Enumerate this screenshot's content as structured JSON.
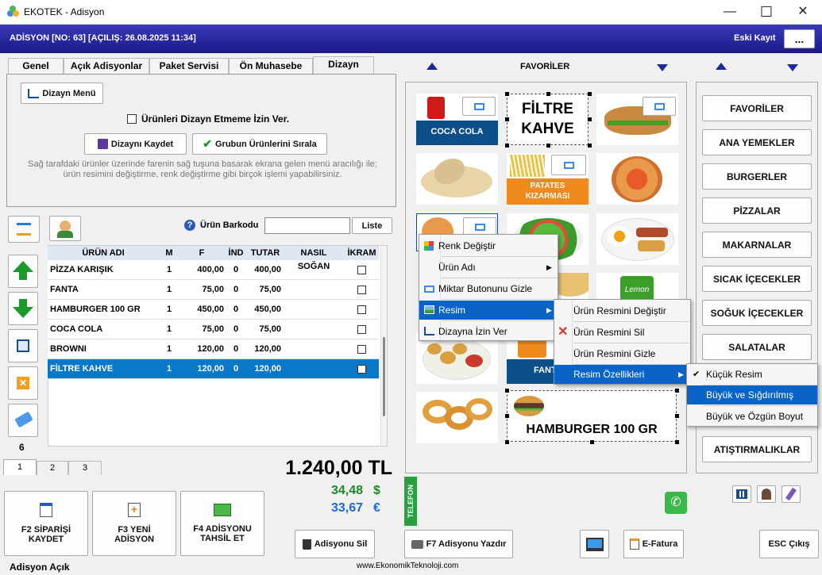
{
  "window": {
    "title": "EKOTEK - Adisyon",
    "min": "—",
    "max": "☐",
    "close": "✕"
  },
  "info": {
    "header": "ADİSYON [NO: 63] [AÇILIŞ: 26.08.2025 11:34]",
    "eski_kayit": "Eski Kayıt",
    "more": "..."
  },
  "tabs": [
    "Genel",
    "Açık Adisyonlar",
    "Paket Servisi",
    "Ön Muhasebe",
    "Dizayn"
  ],
  "design": {
    "menu_btn": "Dizayn Menü",
    "checkbox": "Ürünleri Dizayn Etmeme İzin Ver.",
    "save_btn": "Dizaynı Kaydet",
    "sort_btn": "Grubun Ürünlerini Sırala",
    "help1": "Sağ tarafdaki ürünler üzerinde farenin sağ tuşuna basarak ekrana gelen menü aracılığı ile;",
    "help2": "ürün resimini değiştirme, renk değiştirme gibi birçok işlemi yapabilirsiniz."
  },
  "barcode": {
    "label": "Ürün Barkodu",
    "value": "",
    "list_btn": "Liste"
  },
  "table": {
    "headers": [
      "ÜRÜN ADI",
      "M",
      "F",
      "İND",
      "TUTAR",
      "NASIL",
      "İKRAM"
    ],
    "rows": [
      {
        "name": "PİZZA KARIŞIK",
        "m": "1",
        "f": "400,00",
        "ind": "0",
        "tutar": "400,00",
        "nasil": "SOĞAN"
      },
      {
        "name": "FANTA",
        "m": "1",
        "f": "75,00",
        "ind": "0",
        "tutar": "75,00",
        "nasil": ""
      },
      {
        "name": "HAMBURGER 100 GR",
        "m": "1",
        "f": "450,00",
        "ind": "0",
        "tutar": "450,00",
        "nasil": ""
      },
      {
        "name": "COCA COLA",
        "m": "1",
        "f": "75,00",
        "ind": "0",
        "tutar": "75,00",
        "nasil": ""
      },
      {
        "name": "BROWNI",
        "m": "1",
        "f": "120,00",
        "ind": "0",
        "tutar": "120,00",
        "nasil": ""
      },
      {
        "name": "FİLTRE KAHVE",
        "m": "1",
        "f": "120,00",
        "ind": "0",
        "tutar": "120,00",
        "nasil": ""
      }
    ]
  },
  "item_count": "6",
  "pages": [
    "1",
    "2",
    "3"
  ],
  "totals": {
    "tl": "1.240,00 TL",
    "usd": "34,48",
    "usd_sym": "$",
    "eur": "33,67",
    "eur_sym": "€"
  },
  "telefon": "TELEFON",
  "actions": {
    "f2": "F2 SİPARİŞİ KAYDET",
    "f3": "F3 YENİ ADİSYON",
    "f4": "F4 ADİSYONU TAHSİL ET",
    "sil": "Adisyonu Sil",
    "yazdir": "F7 Adisyonu Yazdır",
    "efatura": "E-Fatura",
    "esc": "ESC Çıkış"
  },
  "status": "Adisyon Açık",
  "website": "www.EkonomikTeknoloji.com",
  "favorites_title": "FAVORİLER",
  "products": {
    "coca_cola": "COCA COLA",
    "filtre1": "FİLTRE",
    "filtre2": "KAHVE",
    "patates1": "PATATES",
    "patates2": "KIZARMASI",
    "hamburger": "HAMBURGER 100 GR",
    "fanta_partial": "FANT",
    "lemon": "Lemon"
  },
  "categories": [
    "FAVORİLER",
    "ANA YEMEKLER",
    "BURGERLER",
    "PİZZALAR",
    "MAKARNALAR",
    "SICAK İÇECEKLER",
    "SOĞUK İÇECEKLER",
    "SALATALAR",
    "ATIŞTIRMALIKLAR"
  ],
  "context_menu": {
    "items": [
      "Renk Değiştir",
      "Ürün Adı",
      "Miktar Butonunu Gizle",
      "Resim",
      "Dizayna İzin Ver"
    ]
  },
  "submenu1": {
    "items": [
      "Ürün Resmini Değiştir",
      "Ürün Resmini Sil",
      "Ürün Resmini Gizle",
      "Resim Özellikleri"
    ]
  },
  "submenu2": {
    "items": [
      "Küçük Resim",
      "Büyük ve Sığdırılmış",
      "Büyük ve Özgün Boyut"
    ],
    "check": "✔"
  },
  "colors": {
    "accent": "#0a64c8",
    "header_bg": "#1a1a8a",
    "coca": "#0d4f8a",
    "patates": "#f08a1c",
    "green": "#1a8a2a",
    "blue_total": "#1a6ad8"
  }
}
